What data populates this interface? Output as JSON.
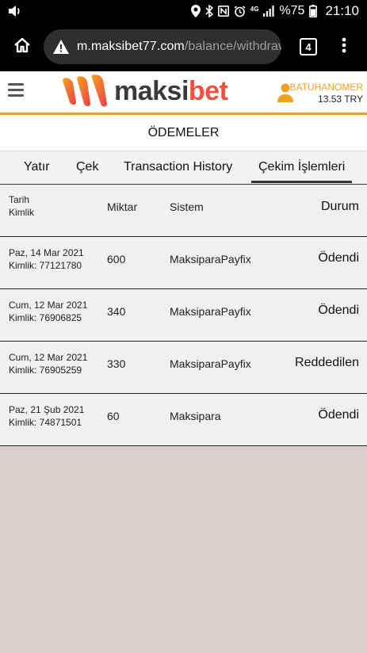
{
  "status_bar": {
    "battery_percent": "%75",
    "time": "21:10",
    "network_type": "4G",
    "icons": [
      "volume-icon",
      "location-icon",
      "bluetooth-icon",
      "nfc-icon",
      "alarm-icon",
      "signal-icon",
      "battery-icon"
    ]
  },
  "browser": {
    "url_domain": "m.maksibet77.com",
    "url_path": "/balance/withdraws",
    "tab_count": "4",
    "icons": [
      "home-icon",
      "warning-icon",
      "tabs-icon",
      "more-vert-icon"
    ]
  },
  "header": {
    "logo_part1": "maksi",
    "logo_part2": "bet",
    "username": "BATUHANOMER",
    "balance": "13.53 TRY",
    "colors": {
      "accent": "#f2a01f",
      "brand_red": "#ef4f3b",
      "dark": "#3a3a3a"
    }
  },
  "page": {
    "title": "ÖDEMELER"
  },
  "tabs": [
    {
      "label": "Yatır"
    },
    {
      "label": "Çek"
    },
    {
      "label": "Transaction History"
    },
    {
      "label": "Çekim İşlemleri",
      "active": true
    }
  ],
  "table": {
    "headers": {
      "date": "Tarih",
      "id": "Kimlik",
      "amount": "Miktar",
      "system": "Sistem",
      "status": "Durum"
    },
    "rows": [
      {
        "date": "Paz, 14 Mar 2021",
        "id": "Kimlik: 77121780",
        "amount": "600",
        "system": "MaksiparaPayfix",
        "status": "Ödendi"
      },
      {
        "date": "Cum, 12 Mar 2021",
        "id": "Kimlik: 76906825",
        "amount": "340",
        "system": "MaksiparaPayfix",
        "status": "Ödendi"
      },
      {
        "date": "Cum, 12 Mar 2021",
        "id": "Kimlik: 76905259",
        "amount": "330",
        "system": "MaksiparaPayfix",
        "status": "Reddedilen"
      },
      {
        "date": "Paz, 21 Şub 2021",
        "id": "Kimlik: 74871501",
        "amount": "60",
        "system": "Maksipara",
        "status": "Ödendi"
      }
    ]
  }
}
